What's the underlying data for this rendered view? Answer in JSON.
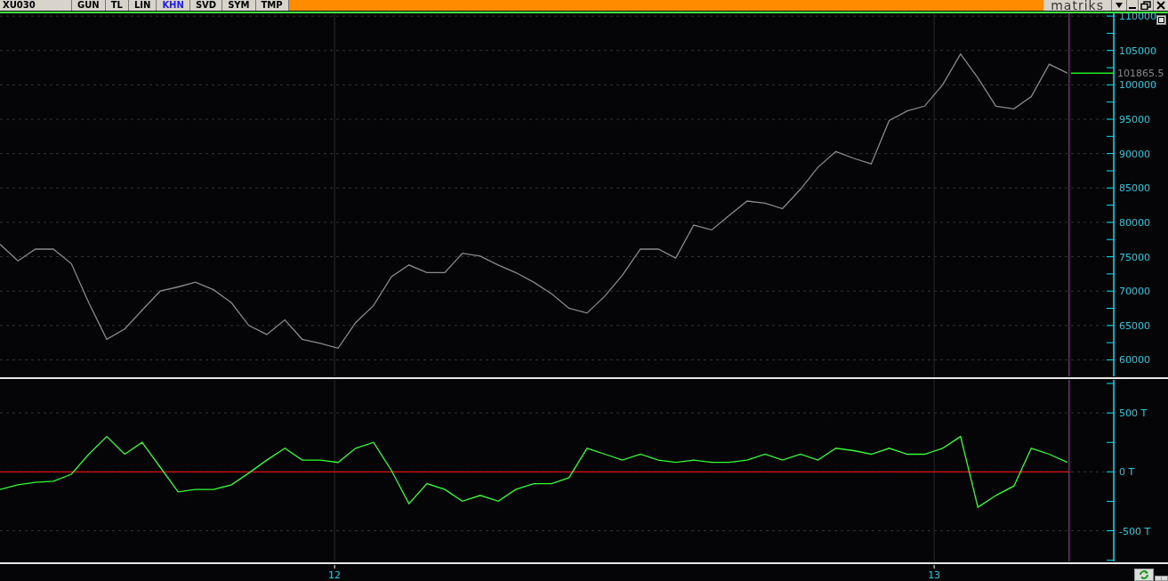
{
  "toolbar": {
    "symbol": "XU030",
    "tabs": [
      {
        "label": "GUN",
        "selected": false
      },
      {
        "label": "TL",
        "selected": false
      },
      {
        "label": "LIN",
        "selected": false
      },
      {
        "label": "KHN",
        "selected": true
      },
      {
        "label": "SVD",
        "selected": false
      },
      {
        "label": "SYM",
        "selected": false
      },
      {
        "label": "TMP",
        "selected": false
      }
    ],
    "brand": "matriks"
  },
  "price_chart": {
    "last_price": "101865.5",
    "chart_data": {
      "type": "line",
      "grid": true,
      "x": [
        11.442,
        11.472,
        11.501,
        11.531,
        11.561,
        11.59,
        11.62,
        11.65,
        11.679,
        11.709,
        11.739,
        11.768,
        11.798,
        11.828,
        11.857,
        11.887,
        11.917,
        11.946,
        11.976,
        12.006,
        12.035,
        12.065,
        12.095,
        12.124,
        12.154,
        12.184,
        12.213,
        12.243,
        12.273,
        12.302,
        12.332,
        12.362,
        12.391,
        12.421,
        12.451,
        12.48,
        12.51,
        12.54,
        12.569,
        12.599,
        12.629,
        12.658,
        12.688,
        12.718,
        12.747,
        12.777,
        12.806,
        12.836,
        12.866,
        12.895,
        12.925,
        12.955,
        12.984,
        13.014,
        13.044,
        13.073,
        13.103,
        13.133,
        13.162,
        13.192,
        13.222
      ],
      "series": [
        {
          "color": "#8a8a8a",
          "values": [
            76800,
            74400,
            76100,
            76100,
            74000,
            68300,
            63000,
            64500,
            67200,
            70000,
            70600,
            71300,
            70200,
            68300,
            65000,
            63700,
            65800,
            63000,
            62400,
            61700,
            65400,
            67900,
            72100,
            73800,
            72700,
            72700,
            75500,
            75100,
            73800,
            72700,
            71300,
            69600,
            67500,
            66800,
            69300,
            72300,
            76100,
            76100,
            74800,
            79600,
            78900,
            81000,
            83100,
            82800,
            82000,
            84800,
            88000,
            90300,
            89300,
            88500,
            94800,
            96200,
            96900,
            100000,
            104500,
            101000,
            96900,
            96500,
            98300,
            103000,
            101700
          ]
        }
      ],
      "xlim": [
        11.442,
        13.39
      ],
      "ylim": [
        57600,
        110400
      ],
      "ref_lines": [
        {
          "axis": "x",
          "value": 12,
          "color": "#2a2a2a"
        },
        {
          "axis": "x",
          "value": 13,
          "color": "#2a2a2a"
        },
        {
          "axis": "x",
          "value": 13.225,
          "color": "#a020a0"
        }
      ],
      "yticks": [
        60000,
        65000,
        70000,
        75000,
        80000,
        85000,
        90000,
        95000,
        100000,
        105000,
        110000
      ]
    }
  },
  "indicator_chart": {
    "chart_data": {
      "type": "line",
      "grid": true,
      "x": [
        11.442,
        11.472,
        11.501,
        11.531,
        11.561,
        11.59,
        11.62,
        11.65,
        11.679,
        11.709,
        11.739,
        11.768,
        11.798,
        11.828,
        11.857,
        11.887,
        11.917,
        11.946,
        11.976,
        12.006,
        12.035,
        12.065,
        12.095,
        12.124,
        12.154,
        12.184,
        12.213,
        12.243,
        12.273,
        12.302,
        12.332,
        12.362,
        12.391,
        12.421,
        12.451,
        12.48,
        12.51,
        12.54,
        12.569,
        12.599,
        12.629,
        12.658,
        12.688,
        12.718,
        12.747,
        12.777,
        12.806,
        12.836,
        12.866,
        12.895,
        12.925,
        12.955,
        12.984,
        13.014,
        13.044,
        13.073,
        13.103,
        13.133,
        13.162,
        13.192,
        13.222
      ],
      "series": [
        {
          "color": "#33ff33",
          "values": [
            -150,
            -110,
            -90,
            -80,
            -20,
            150,
            300,
            150,
            250,
            40,
            -170,
            -150,
            -150,
            -110,
            -10,
            100,
            200,
            100,
            100,
            80,
            200,
            250,
            10,
            -270,
            -100,
            -150,
            -250,
            -200,
            -250,
            -150,
            -100,
            -100,
            -50,
            200,
            150,
            100,
            150,
            100,
            80,
            100,
            80,
            80,
            100,
            150,
            100,
            150,
            100,
            200,
            180,
            150,
            200,
            150,
            150,
            200,
            300,
            -300,
            -200,
            -120,
            200,
            150,
            80
          ]
        }
      ],
      "xlim": [
        11.442,
        13.39
      ],
      "ylim": [
        -760,
        780
      ],
      "ref_lines": [
        {
          "axis": "x",
          "value": 12,
          "color": "#2a2a2a"
        },
        {
          "axis": "x",
          "value": 13,
          "color": "#2a2a2a"
        },
        {
          "axis": "x",
          "value": 13.225,
          "color": "#a020a0"
        },
        {
          "axis": "y",
          "value": 0,
          "color": "#e01010"
        }
      ],
      "yticks": [
        {
          "value": -500,
          "label": "-500 T"
        },
        {
          "value": 0,
          "label": "0 T"
        },
        {
          "value": 500,
          "label": "500 T"
        }
      ],
      "xticks": [
        {
          "value": 12,
          "label": "12"
        },
        {
          "value": 13,
          "label": "13"
        }
      ]
    }
  }
}
